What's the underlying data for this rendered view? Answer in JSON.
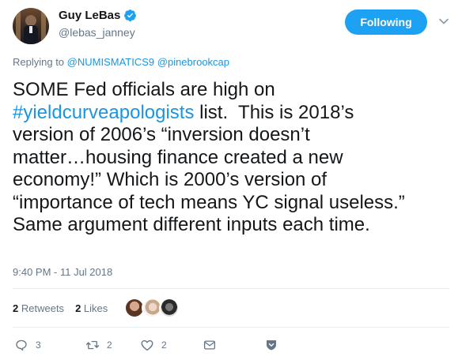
{
  "user": {
    "display_name": "Guy LeBas",
    "handle": "@lebas_janney",
    "follow_label": "Following"
  },
  "reply": {
    "prefix": "Replying to",
    "mentions": [
      "@NUMISMATICS9",
      "@pinebrookcap"
    ]
  },
  "tweet": {
    "line1": "SOME Fed officials are high on",
    "hashtag": "#yieldcurveapologists",
    "line2_rest": " list.  This is 2018’s",
    "line3": "version of 2006’s “inversion doesn’t",
    "line4": "matter…housing finance created a new",
    "line5": "economy!” Which is 2000’s version of",
    "line6": "“importance of tech means YC signal useless.”",
    "line7": "Same argument different inputs each time.",
    "timestamp": "9:40 PM - 11 Jul 2018"
  },
  "stats": {
    "retweets_count": "2",
    "retweets_label": "Retweets",
    "likes_count": "2",
    "likes_label": "Likes"
  },
  "actions": {
    "reply_count": "3",
    "retweet_count": "2",
    "like_count": "2"
  },
  "colors": {
    "accent": "#1da1f2",
    "link": "#1b95e0",
    "muted": "#657786"
  },
  "icons": [
    "verified-icon",
    "chevron-down-icon",
    "reply-icon",
    "retweet-icon",
    "like-icon",
    "message-icon",
    "bookmark-icon"
  ]
}
